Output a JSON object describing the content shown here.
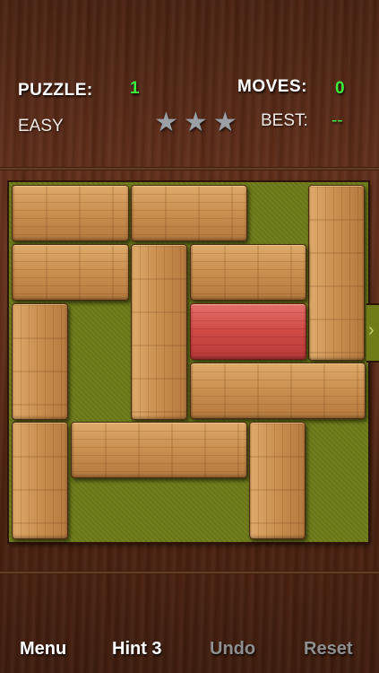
{
  "header": {
    "puzzle_label": "PUZZLE:",
    "puzzle_number": "1",
    "moves_label": "MOVES:",
    "moves_value": "0",
    "difficulty": "EASY",
    "best_label": "BEST:",
    "best_value": "--",
    "stars_total": 3,
    "stars_earned": 0
  },
  "board": {
    "grid_size": 6,
    "exit_row": 3,
    "target_color": "#d9534f",
    "grid_color": "#6f7c18"
  },
  "toolbar": {
    "menu_label": "Menu",
    "hint_label": "Hint 3",
    "undo_label": "Undo",
    "reset_label": "Reset"
  },
  "icons": [
    "star-icon",
    "exit-arrow-icon"
  ]
}
